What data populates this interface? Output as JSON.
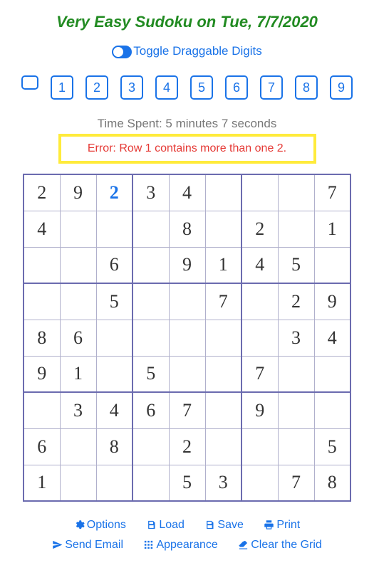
{
  "title": "Very Easy Sudoku on Tue, 7/7/2020",
  "toggle_label": "Toggle Draggable Digits",
  "digits": [
    "1",
    "2",
    "3",
    "4",
    "5",
    "6",
    "7",
    "8",
    "9"
  ],
  "timer_text": "Time Spent: 5 minutes 7 seconds",
  "error_text": "Error: Row 1 contains more than one 2.",
  "grid": [
    [
      {
        "v": "2"
      },
      {
        "v": "9"
      },
      {
        "v": "2",
        "entered": true
      },
      {
        "v": "3"
      },
      {
        "v": "4"
      },
      {
        "v": ""
      },
      {
        "v": ""
      },
      {
        "v": ""
      },
      {
        "v": "7"
      }
    ],
    [
      {
        "v": "4"
      },
      {
        "v": ""
      },
      {
        "v": ""
      },
      {
        "v": ""
      },
      {
        "v": "8"
      },
      {
        "v": ""
      },
      {
        "v": "2"
      },
      {
        "v": ""
      },
      {
        "v": "1"
      }
    ],
    [
      {
        "v": ""
      },
      {
        "v": ""
      },
      {
        "v": "6"
      },
      {
        "v": ""
      },
      {
        "v": "9"
      },
      {
        "v": "1"
      },
      {
        "v": "4"
      },
      {
        "v": "5"
      },
      {
        "v": ""
      }
    ],
    [
      {
        "v": ""
      },
      {
        "v": ""
      },
      {
        "v": "5"
      },
      {
        "v": ""
      },
      {
        "v": ""
      },
      {
        "v": "7"
      },
      {
        "v": ""
      },
      {
        "v": "2"
      },
      {
        "v": "9"
      }
    ],
    [
      {
        "v": "8"
      },
      {
        "v": "6"
      },
      {
        "v": ""
      },
      {
        "v": ""
      },
      {
        "v": ""
      },
      {
        "v": ""
      },
      {
        "v": ""
      },
      {
        "v": "3"
      },
      {
        "v": "4"
      }
    ],
    [
      {
        "v": "9"
      },
      {
        "v": "1"
      },
      {
        "v": ""
      },
      {
        "v": "5"
      },
      {
        "v": ""
      },
      {
        "v": ""
      },
      {
        "v": "7"
      },
      {
        "v": ""
      },
      {
        "v": ""
      }
    ],
    [
      {
        "v": ""
      },
      {
        "v": "3"
      },
      {
        "v": "4"
      },
      {
        "v": "6"
      },
      {
        "v": "7"
      },
      {
        "v": ""
      },
      {
        "v": "9"
      },
      {
        "v": ""
      },
      {
        "v": ""
      }
    ],
    [
      {
        "v": "6"
      },
      {
        "v": ""
      },
      {
        "v": "8"
      },
      {
        "v": ""
      },
      {
        "v": "2"
      },
      {
        "v": ""
      },
      {
        "v": ""
      },
      {
        "v": ""
      },
      {
        "v": "5"
      }
    ],
    [
      {
        "v": "1"
      },
      {
        "v": ""
      },
      {
        "v": ""
      },
      {
        "v": ""
      },
      {
        "v": "5"
      },
      {
        "v": "3"
      },
      {
        "v": ""
      },
      {
        "v": "7"
      },
      {
        "v": "8"
      }
    ]
  ],
  "buttons": {
    "options": "Options",
    "load": "Load",
    "save": "Save",
    "print": "Print",
    "send_email": "Send Email",
    "appearance": "Appearance",
    "clear": "Clear the Grid"
  }
}
